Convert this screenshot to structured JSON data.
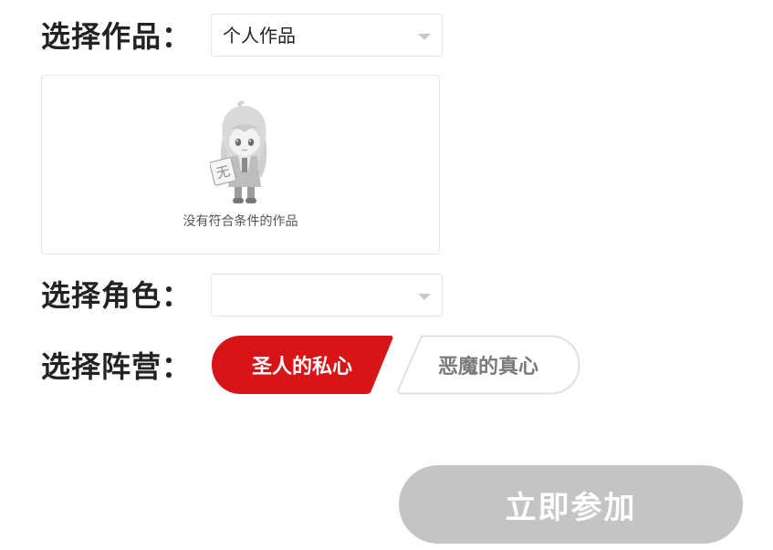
{
  "work": {
    "label": "选择作品：",
    "selected": "个人作品",
    "empty_text": "没有符合条件的作品",
    "empty_badge": "无"
  },
  "role": {
    "label": "选择角色：",
    "selected": ""
  },
  "camp": {
    "label": "选择阵营：",
    "options": [
      {
        "label": "圣人的私心",
        "selected": true
      },
      {
        "label": "恶魔的真心",
        "selected": false
      }
    ]
  },
  "submit": {
    "label": "立即参加"
  },
  "colors": {
    "accent": "#d71518",
    "disabled_button": "#c4c4c4",
    "border": "#e3e3e3"
  }
}
